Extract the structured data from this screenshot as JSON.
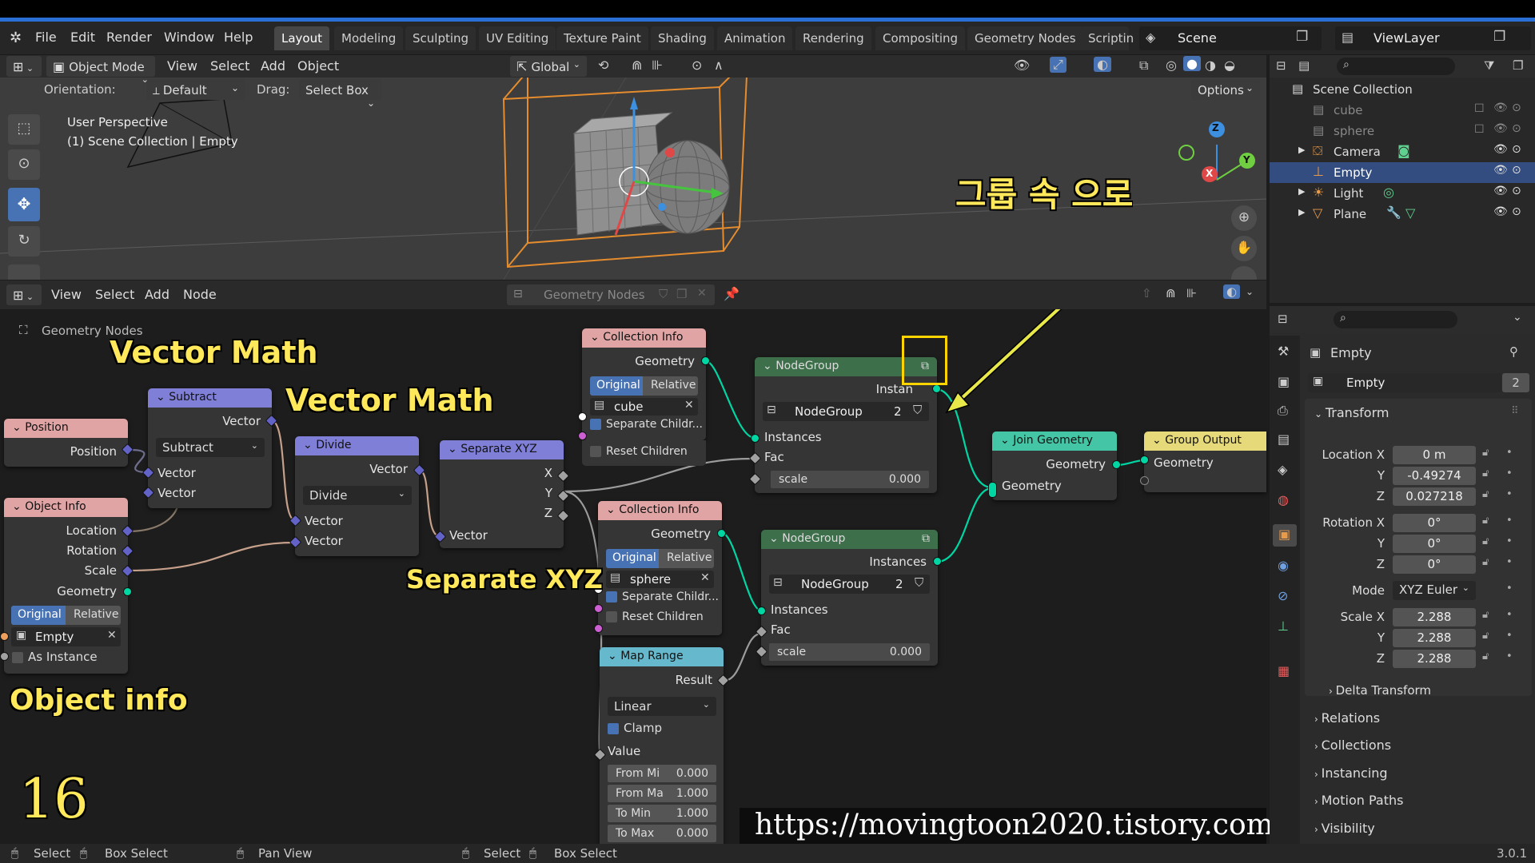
{
  "topbar": {
    "menus": [
      "File",
      "Edit",
      "Render",
      "Window",
      "Help"
    ],
    "workspaces": [
      "Layout",
      "Modeling",
      "Sculpting",
      "UV Editing",
      "Texture Paint",
      "Shading",
      "Animation",
      "Rendering",
      "Compositing",
      "Geometry Nodes",
      "Scriptin"
    ],
    "active_workspace": "Layout",
    "scene": "Scene",
    "view_layer": "ViewLayer"
  },
  "viewport": {
    "mode": "Object Mode",
    "menus": [
      "View",
      "Select",
      "Add",
      "Object"
    ],
    "transform_orientation": "Global",
    "orientation_label": "Orientation:",
    "orientation_value": "Default",
    "drag_label": "Drag:",
    "drag_value": "Select Box",
    "options_label": "Options",
    "perspective": "User Perspective",
    "context": "(1) Scene Collection | Empty",
    "gizmo": {
      "x": "X",
      "y": "Y",
      "z": "Z"
    }
  },
  "node_editor": {
    "menus": [
      "View",
      "Select",
      "Add",
      "Node"
    ],
    "tree_name": "Geometry Nodes",
    "breadcrumb": "Geometry Nodes",
    "nodes": {
      "position": {
        "title": "Position",
        "out": "Position"
      },
      "object_info": {
        "title": "Object Info",
        "outs": [
          "Location",
          "Rotation",
          "Scale",
          "Geometry"
        ],
        "toggle_a": "Original",
        "toggle_b": "Relative",
        "object": "Empty",
        "as_instance": "As Instance"
      },
      "subtract": {
        "title": "Subtract",
        "out": "Vector",
        "op": "Subtract",
        "in1": "Vector",
        "in2": "Vector"
      },
      "divide": {
        "title": "Divide",
        "out": "Vector",
        "op": "Divide",
        "in1": "Vector",
        "in2": "Vector"
      },
      "separate": {
        "title": "Separate XYZ",
        "outs": [
          "X",
          "Y",
          "Z"
        ],
        "in": "Vector"
      },
      "coll1": {
        "title": "Collection Info",
        "out": "Geometry",
        "toggle_a": "Original",
        "toggle_b": "Relative",
        "collection": "cube",
        "sep": "Separate Childr...",
        "reset": "Reset Children"
      },
      "coll2": {
        "title": "Collection Info",
        "out": "Geometry",
        "toggle_a": "Original",
        "toggle_b": "Relative",
        "collection": "sphere",
        "sep": "Separate Childr...",
        "reset": "Reset Children"
      },
      "maprange": {
        "title": "Map Range",
        "out": "Result",
        "mode": "Linear",
        "clamp": "Clamp",
        "value": "Value",
        "fields": [
          {
            "label": "From Mi",
            "value": "0.000"
          },
          {
            "label": "From Ma",
            "value": "1.000"
          },
          {
            "label": "To Min",
            "value": "1.000"
          },
          {
            "label": "To Max",
            "value": "0.000"
          }
        ]
      },
      "ng1": {
        "title": "NodeGroup",
        "out": "Instances",
        "out_visible": "Instan",
        "group": "NodeGroup",
        "users": "2",
        "in1": "Instances",
        "in2": "Fac",
        "scale_label": "scale",
        "scale_value": "0.000"
      },
      "ng2": {
        "title": "NodeGroup",
        "out": "Instances",
        "group": "NodeGroup",
        "users": "2",
        "in1": "Instances",
        "in2": "Fac",
        "scale_label": "scale",
        "scale_value": "0.000"
      },
      "join": {
        "title": "Join Geometry",
        "out": "Geometry",
        "in": "Geometry"
      },
      "output": {
        "title": "Group Output",
        "in": "Geometry"
      }
    }
  },
  "annotations": {
    "vector_math_1": "Vector Math",
    "vector_math_2": "Vector Math",
    "separate_xyz": "Separate XYZ",
    "object_info": "Object info",
    "korean": "그룹 속 으로",
    "number": "16",
    "url": "https://movingtoon2020.tistory.com"
  },
  "outliner": {
    "root": "Scene Collection",
    "items": [
      {
        "name": "cube",
        "dim": true
      },
      {
        "name": "sphere",
        "dim": true
      },
      {
        "name": "Camera",
        "dim": false
      },
      {
        "name": "Empty",
        "dim": false
      },
      {
        "name": "Light",
        "dim": false
      },
      {
        "name": "Plane",
        "dim": false
      }
    ]
  },
  "properties": {
    "object_name": "Empty",
    "datablock": "Empty",
    "users": "2",
    "transform": "Transform",
    "location_label": "Location X",
    "location": [
      "0 m",
      "-0.49274",
      "0.027218"
    ],
    "rotation_label": "Rotation X",
    "rotation": [
      "0°",
      "0°",
      "0°"
    ],
    "mode_label": "Mode",
    "mode": "XYZ Euler",
    "scale_label": "Scale X",
    "scale": [
      "2.288",
      "2.288",
      "2.288"
    ],
    "axis_y": "Y",
    "axis_z": "Z",
    "sections": [
      "Delta Transform",
      "Relations",
      "Collections",
      "Instancing",
      "Motion Paths",
      "Visibility"
    ]
  },
  "status": {
    "select": "Select",
    "box_select": "Box Select",
    "pan_view": "Pan View",
    "select2": "Select",
    "box_select2": "Box Select",
    "version": "3.0.1"
  },
  "colors": {
    "accent": "#4772b3",
    "annotation": "#ffe85a",
    "geometry_socket": "#00d6a3",
    "vector_socket": "#6363c7"
  }
}
